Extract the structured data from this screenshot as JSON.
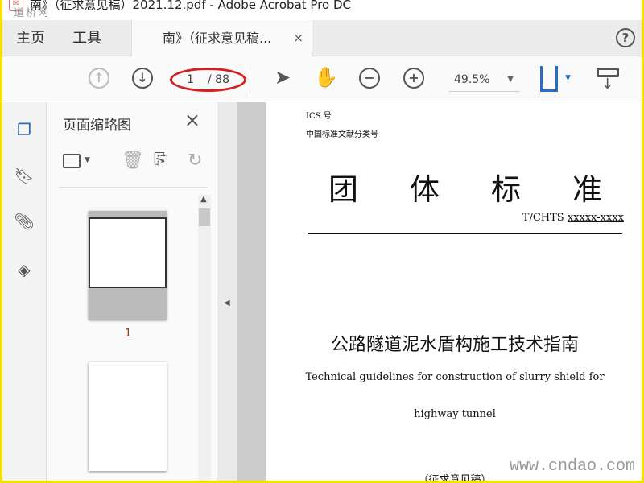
{
  "window": {
    "title": "南》（征求意见稿）2021.12.pdf - Adobe Acrobat Pro DC",
    "watermark_top": "道桥网",
    "watermark_bottom": "www.cndao.com"
  },
  "tabs": {
    "home": "主页",
    "tools": "工具",
    "document": "南》（征求意见稿...",
    "close": "×",
    "help": "?"
  },
  "toolbar": {
    "current_page": "1",
    "total_pages": "/ 88",
    "zoom": "49.5%"
  },
  "panel": {
    "title": "页面缩略图",
    "close": "×",
    "thumb_label": "1"
  },
  "page": {
    "ics": "ICS 号",
    "clc": "中国标准文献分类号",
    "heading": [
      "团",
      "体",
      "标",
      "准"
    ],
    "code_prefix": "T/CHTS ",
    "code": "xxxxx-xxxx",
    "title_cn": "公路隧道泥水盾构施工技术指南",
    "title_en_1": "Technical guidelines for construction of slurry shield for",
    "title_en_2": "highway tunnel",
    "draft": "（征求意见稿）"
  }
}
